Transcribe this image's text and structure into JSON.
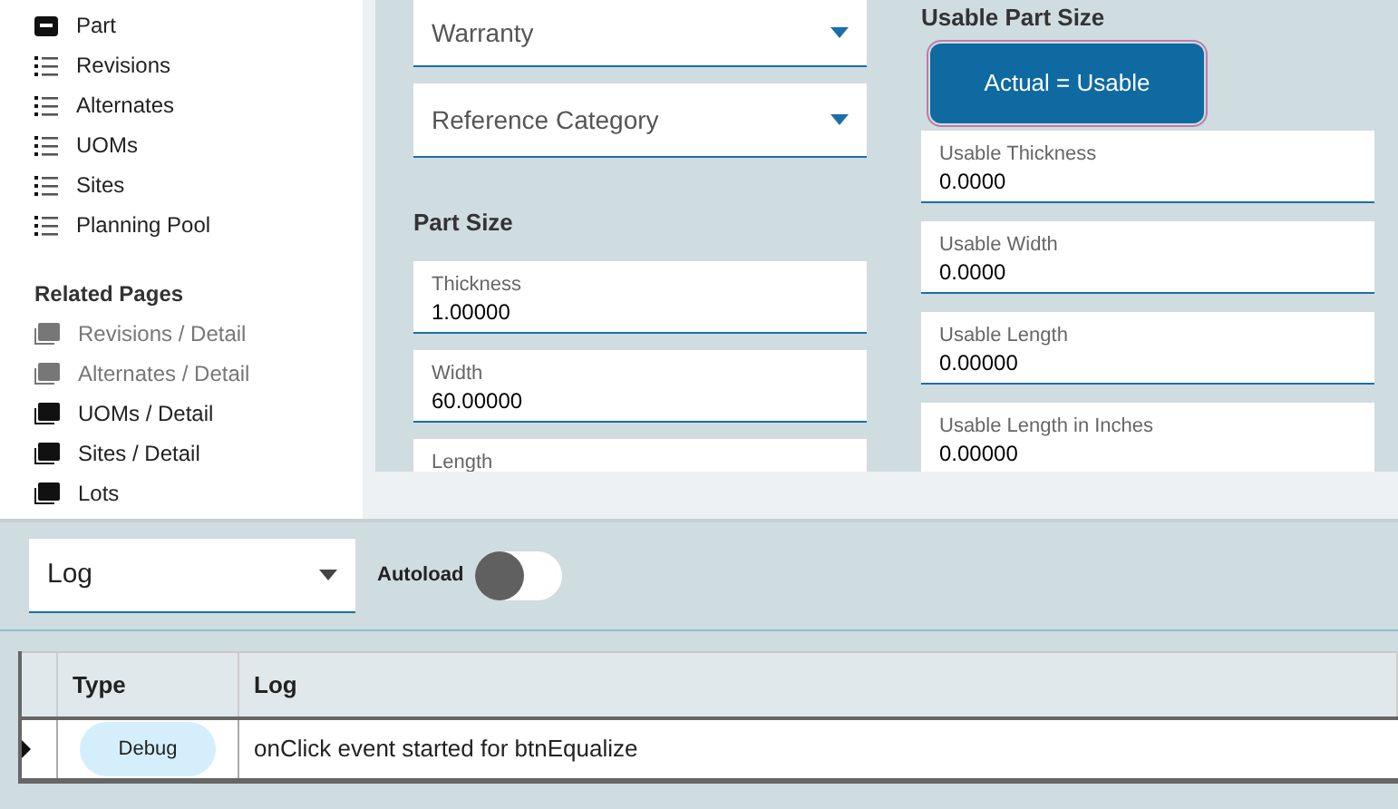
{
  "sidebar": {
    "items": [
      {
        "label": "Part",
        "kind": "form"
      },
      {
        "label": "Revisions",
        "kind": "list"
      },
      {
        "label": "Alternates",
        "kind": "list"
      },
      {
        "label": "UOMs",
        "kind": "list"
      },
      {
        "label": "Sites",
        "kind": "list"
      },
      {
        "label": "Planning Pool",
        "kind": "list"
      }
    ],
    "related_heading": "Related Pages",
    "related": [
      {
        "label": "Revisions / Detail",
        "disabled": true
      },
      {
        "label": "Alternates / Detail",
        "disabled": true
      },
      {
        "label": "UOMs / Detail",
        "disabled": false
      },
      {
        "label": "Sites / Detail",
        "disabled": false
      },
      {
        "label": "Lots",
        "disabled": false
      }
    ]
  },
  "form": {
    "left": [
      {
        "kind": "select",
        "placeholder": "Warranty"
      },
      {
        "kind": "select",
        "placeholder": "Reference Category"
      },
      {
        "kind": "heading",
        "text": "Part Size"
      },
      {
        "kind": "input",
        "label": "Thickness",
        "value": "1.00000"
      },
      {
        "kind": "input",
        "label": "Width",
        "value": "60.00000"
      },
      {
        "kind": "input",
        "label": "Length"
      }
    ],
    "right": [
      {
        "kind": "heading",
        "text": "Usable Part Size"
      },
      {
        "kind": "button",
        "text": "Actual = Usable"
      },
      {
        "kind": "input",
        "label": "Usable Thickness",
        "value": "0.0000"
      },
      {
        "kind": "input",
        "label": "Usable Width",
        "value": "0.0000"
      },
      {
        "kind": "input",
        "label": "Usable Length",
        "value": "0.00000"
      },
      {
        "kind": "input",
        "label": "Usable Length in Inches",
        "value": "0.00000"
      }
    ]
  },
  "log_panel": {
    "select": {
      "value": "Log"
    },
    "autoload": {
      "label": "Autoload",
      "on": false
    },
    "table": {
      "columns": [
        "Type",
        "Log"
      ],
      "rows": [
        {
          "type": "Debug",
          "log": "onClick event started for btnEqualize",
          "selected": true
        }
      ]
    }
  }
}
